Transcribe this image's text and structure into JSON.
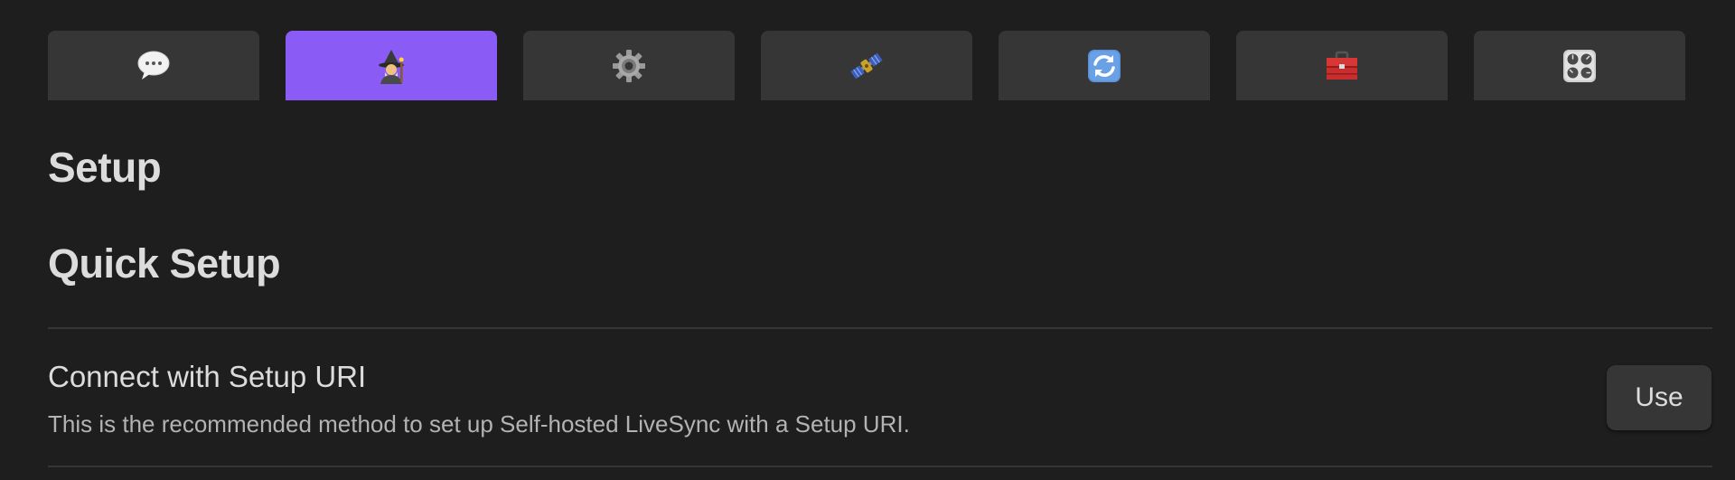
{
  "tabs": [
    {
      "icon": "speech-bubble-icon",
      "active": false
    },
    {
      "icon": "mage-icon",
      "active": true
    },
    {
      "icon": "gear-icon",
      "active": false
    },
    {
      "icon": "satellite-icon",
      "active": false
    },
    {
      "icon": "sync-arrows-icon",
      "active": false
    },
    {
      "icon": "toolbox-icon",
      "active": false
    },
    {
      "icon": "control-knobs-icon",
      "active": false
    }
  ],
  "colors": {
    "background": "#1e1e1e",
    "tab_bg": "#363636",
    "tab_active_bg": "#8a5cf5",
    "button_bg": "#363636",
    "text": "#dcdcdc",
    "muted_text": "#b3b3b3"
  },
  "page": {
    "title": "Setup",
    "section_title": "Quick Setup"
  },
  "settings": [
    {
      "name": "Connect with Setup URI",
      "description": "This is the recommended method to set up Self-hosted LiveSync with a Setup URI.",
      "button_label": "Use"
    }
  ]
}
